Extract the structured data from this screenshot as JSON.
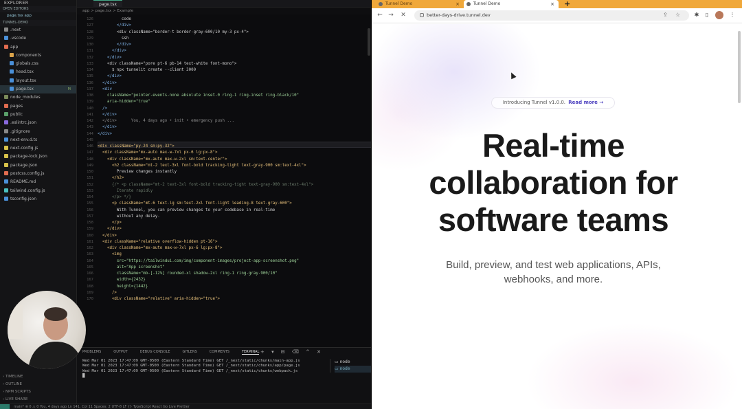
{
  "vscode": {
    "explorer_title": "EXPLORER",
    "open_editors_label": "OPEN EDITORS",
    "open_file": "page.tsx app",
    "project_label": "TUNNEL-DEMO",
    "tree": [
      {
        "label": ".next",
        "color": "#8a8a8a",
        "indent": 6
      },
      {
        "label": ".vscode",
        "color": "#4a90d9",
        "indent": 6
      },
      {
        "label": "app",
        "color": "#e06c50",
        "indent": 6
      },
      {
        "label": "components",
        "color": "#d8a24a",
        "indent": 14
      },
      {
        "label": "globals.css",
        "color": "#4a90d9",
        "indent": 14
      },
      {
        "label": "head.tsx",
        "color": "#4a90d9",
        "indent": 14
      },
      {
        "label": "layout.tsx",
        "color": "#4a90d9",
        "indent": 14
      },
      {
        "label": "page.tsx",
        "color": "#4a90d9",
        "indent": 14,
        "selected": true,
        "badge": "M"
      },
      {
        "label": "node_modules",
        "color": "#7a8a5a",
        "indent": 6
      },
      {
        "label": "pages",
        "color": "#e06c50",
        "indent": 6
      },
      {
        "label": "public",
        "color": "#5aa06a",
        "indent": 6
      },
      {
        "label": ".eslintrc.json",
        "color": "#8a6adf",
        "indent": 6
      },
      {
        "label": ".gitignore",
        "color": "#888888",
        "indent": 6
      },
      {
        "label": "next-env.d.ts",
        "color": "#4a90d9",
        "indent": 6
      },
      {
        "label": "next.config.js",
        "color": "#d8c24a",
        "indent": 6
      },
      {
        "label": "package-lock.json",
        "color": "#d8c24a",
        "indent": 6
      },
      {
        "label": "package.json",
        "color": "#d8c24a",
        "indent": 6
      },
      {
        "label": "postcss.config.js",
        "color": "#e06c50",
        "indent": 6
      },
      {
        "label": "README.md",
        "color": "#4a90d9",
        "indent": 6
      },
      {
        "label": "tailwind.config.js",
        "color": "#4ac0c0",
        "indent": 6
      },
      {
        "label": "tsconfig.json",
        "color": "#4a90d9",
        "indent": 6
      }
    ],
    "bottom_sections": [
      "TIMELINE",
      "OUTLINE",
      "NPM SCRIPTS",
      "LIVE SHARE"
    ],
    "tab_label": "page.tsx",
    "breadcrumb": "app > page.tsx > Example",
    "line_start": 126,
    "code_lines": [
      {
        "t": "          code",
        "c": "#d0d0d0"
      },
      {
        "t": "        </div>",
        "c": "#7fb2e6"
      },
      {
        "t": "        <div className=\"border-t border-gray-600/10 my-3 px-4\">",
        "c": "#d0d0d0"
      },
      {
        "t": "          ssh",
        "c": "#d0d0d0"
      },
      {
        "t": "        </div>",
        "c": "#7fb2e6"
      },
      {
        "t": "      </div>",
        "c": "#7fb2e6"
      },
      {
        "t": "    </div>",
        "c": "#7fb2e6"
      },
      {
        "t": "    <div className=\"pore pt-6 pb-14 text-white font-mono\">",
        "c": "#d0d0d0"
      },
      {
        "t": "      $ npx tunnelit create --client 3000",
        "c": "#d0d0d0"
      },
      {
        "t": "    </div>",
        "c": "#7fb2e6"
      },
      {
        "t": "  </div>",
        "c": "#7fb2e6"
      },
      {
        "t": "  <div",
        "c": "#7fb2e6"
      },
      {
        "t": "    className=\"pointer-events-none absolute inset-0 ring-1 ring-inset ring-black/10\"",
        "c": "#9fd39a"
      },
      {
        "t": "    aria-hidden=\"true\"",
        "c": "#9fd39a"
      },
      {
        "t": "  />",
        "c": "#7fb2e6"
      },
      {
        "t": "  </div>",
        "c": "#7fb2e6"
      },
      {
        "t": "  </div>      You, 4 days ago • init • emergency push ...",
        "c": "#8a8a8a"
      },
      {
        "t": "  </div>",
        "c": "#7fb2e6"
      },
      {
        "t": "</div>",
        "c": "#7fb2e6"
      },
      {
        "t": "",
        "c": "#d0d0d0"
      },
      {
        "t": "<div className=\"py-24 sm:py-32\">",
        "c": "#e6c07b"
      },
      {
        "t": "  <div className=\"mx-auto max-w-7xl px-6 lg:px-8\">",
        "c": "#e6c07b"
      },
      {
        "t": "    <div className=\"mx-auto max-w-2xl sm:text-center\">",
        "c": "#e6c07b"
      },
      {
        "t": "      <h2 className=\"mt-2 text-3xl font-bold tracking-tight text-gray-900 sm:text-4xl\">",
        "c": "#e6c07b"
      },
      {
        "t": "        Preview changes instantly",
        "c": "#d0d0d0"
      },
      {
        "t": "      </h2>",
        "c": "#e6c07b"
      },
      {
        "t": "      {/* <p className=\"mt-2 text-3xl font-bold tracking-tight text-gray-900 sm:text-4xl\">",
        "c": "#6a7a6a"
      },
      {
        "t": "        Iterate rapidly",
        "c": "#6a7a6a"
      },
      {
        "t": "      </p> */}",
        "c": "#6a7a6a"
      },
      {
        "t": "      <p className=\"mt-6 text-lg sm:text-2xl font-light leading-8 text-gray-600\">",
        "c": "#e6c07b"
      },
      {
        "t": "        With Tunnel, you can preview changes to your codebase in real-time",
        "c": "#d0d0d0"
      },
      {
        "t": "        without any delay.",
        "c": "#d0d0d0"
      },
      {
        "t": "      </p>",
        "c": "#e6c07b"
      },
      {
        "t": "    </div>",
        "c": "#e6c07b"
      },
      {
        "t": "  </div>",
        "c": "#e6c07b"
      },
      {
        "t": "  <div className=\"relative overflow-hidden pt-16\">",
        "c": "#e6c07b"
      },
      {
        "t": "    <div className=\"mx-auto max-w-7xl px-6 lg:px-8\">",
        "c": "#e6c07b"
      },
      {
        "t": "      <img",
        "c": "#e6c07b"
      },
      {
        "t": "        src=\"https://tailwindui.com/img/component-images/project-app-screenshot.png\"",
        "c": "#9fd39a"
      },
      {
        "t": "        alt=\"App screenshot\"",
        "c": "#9fd39a"
      },
      {
        "t": "        className=\"mb-[-12%] rounded-xl shadow-2xl ring-1 ring-gray-900/10\"",
        "c": "#9fd39a"
      },
      {
        "t": "        width={2432}",
        "c": "#9fd39a"
      },
      {
        "t": "        height={1442}",
        "c": "#9fd39a"
      },
      {
        "t": "      />",
        "c": "#e6c07b"
      },
      {
        "t": "      <div className=\"relative\" aria-hidden=\"true\">",
        "c": "#e6c07b"
      }
    ],
    "panel_tabs": [
      "PROBLEMS",
      "OUTPUT",
      "DEBUG CONSOLE",
      "GITLENS",
      "COMMENTS",
      "TERMINAL"
    ],
    "terminal_lines": [
      "Wed Mar 01 2023 17:47:09 GMT-0500 (Eastern Standard Time) GET /_next/static/chunks/main-app.js",
      "Wed Mar 01 2023 17:47:09 GMT-0500 (Eastern Standard Time) GET /_next/static/chunks/app/page.js",
      "Wed Mar 01 2023 17:47:09 GMT-0500 (Eastern Standard Time) GET /_next/static/chunks/webpack.js",
      "█"
    ],
    "terminal_list": [
      "node",
      "node"
    ],
    "statusbar": "main*   ⊗ 0 ⚠ 0   You, 4 days ago   Ln 141, Col 11   Spaces: 2   UTF-8   LF   {} TypeScript React   Go Live   Prettier"
  },
  "browser": {
    "tabs": [
      {
        "title": "Tunnel Demo"
      },
      {
        "title": "Tunnel Demo"
      }
    ],
    "new_tab": "+",
    "url": "better-days-drive.tunnel.dev",
    "page": {
      "announcement": "Introducing Tunnel v1.0.0.",
      "announcement_link": "Read more →",
      "headline_1": "Real-time",
      "headline_2": "collaboration for",
      "headline_3": "software teams",
      "subheadline_1": "Build, preview, and test web applications, APIs,",
      "subheadline_2": "webhooks, and more."
    }
  },
  "colors": {
    "tab_strip": "#f0a83a",
    "announcement_link": "#4b3fbf",
    "headline": "#1a1a1a"
  }
}
